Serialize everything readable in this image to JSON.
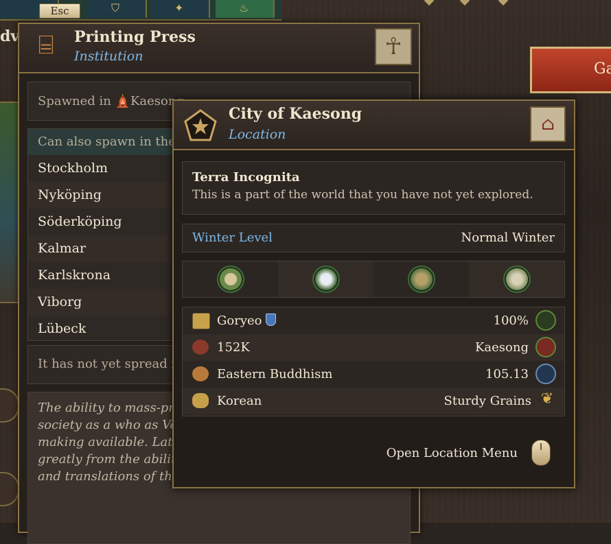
{
  "topbar": {
    "esc_label": "Esc",
    "left_edge_text": "dv"
  },
  "banner": {
    "label": "Ga"
  },
  "printing_press": {
    "title": "Printing Press",
    "subtitle": "Institution",
    "spawned_text": "Spawned in 🛕Kaesong",
    "also_spawn_header": "Can also spawn in the fo",
    "locations": [
      "Stockholm",
      "Nyköping",
      "Söderköping",
      "Kalmar",
      "Karlskrona",
      "Viborg",
      "Lübeck"
    ],
    "not_spread_text": "It has not yet spread int",
    "description": "The ability to mass-prod revolutionize the spread modern society as a who as Venetian Printer Aldu Renaissance by making available. Later the Reformation benefitted greatly from the ability to spread critical publications and translations of the"
  },
  "city": {
    "title": "City of Kaesong",
    "subtitle": "Location",
    "terra_title": "Terra Incognita",
    "terra_desc": "This is a part of the world that you have not yet explored.",
    "winter_label": "Winter Level",
    "winter_value": "Normal Winter",
    "terrain_icons": [
      "flatland-icon",
      "winter-climate-icon",
      "grassland-icon",
      "stone-icon"
    ],
    "stats": [
      {
        "left": "Goryeo",
        "right": "100%",
        "left_icon": "flag-icon",
        "right_icon": "key-icon"
      },
      {
        "left": "152K",
        "right": "Kaesong",
        "left_icon": "population-icon",
        "right_icon": "market-icon"
      },
      {
        "left": "Eastern Buddhism",
        "right": "105.13",
        "left_icon": "religion-icon",
        "right_icon": "building-icon"
      },
      {
        "left": "Korean",
        "right": "Sturdy Grains",
        "left_icon": "culture-icon",
        "right_icon": "grain-icon"
      }
    ],
    "open_menu_label": "Open Location Menu"
  },
  "colors": {
    "gold_border": "#8a7445",
    "subtitle_blue": "#7fb8e6",
    "banner_red": "#b33a26"
  }
}
